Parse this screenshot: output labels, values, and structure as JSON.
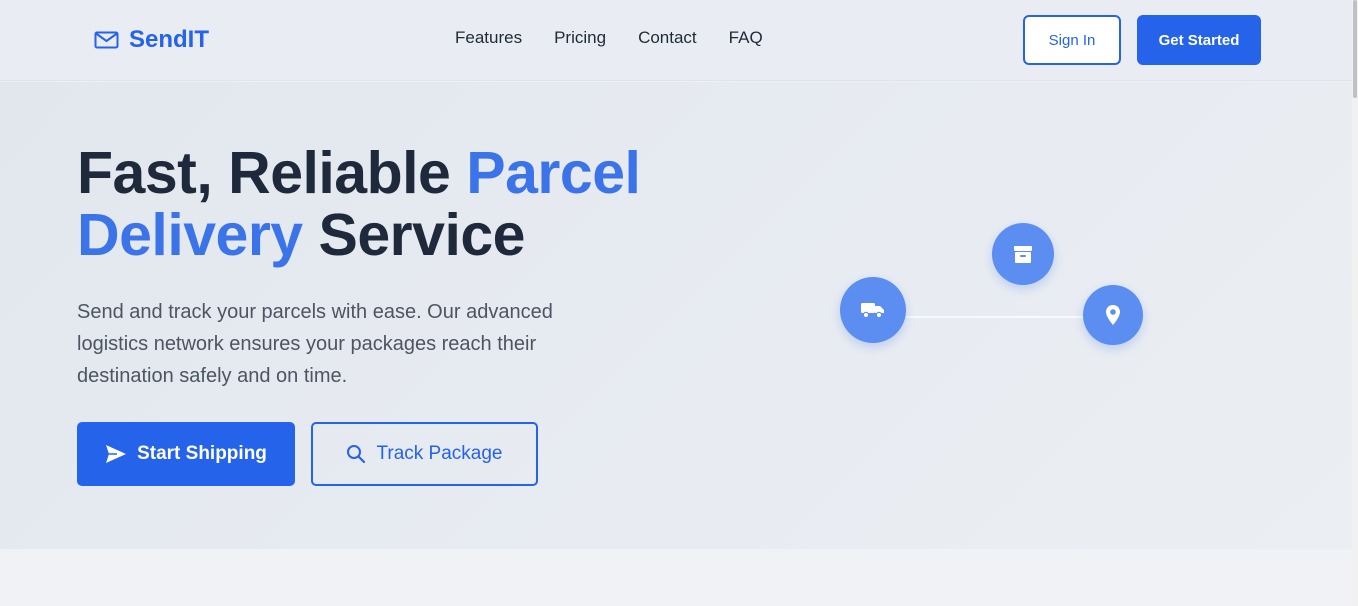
{
  "header": {
    "brand": "SendIT",
    "nav": [
      "Features",
      "Pricing",
      "Contact",
      "FAQ"
    ],
    "sign_in": "Sign In",
    "get_started": "Get Started"
  },
  "hero": {
    "title_part1": "Fast, Reliable ",
    "title_accent1": "Parcel",
    "title_accent2": "Delivery",
    "title_part2": " Service",
    "subtitle": "Send and track your parcels with ease. Our advanced logistics network ensures your packages reach their destination safely and on time.",
    "start_shipping": "Start Shipping",
    "track_package": "Track Package"
  },
  "illustration": {
    "icons": [
      "truck-icon",
      "archive-box-icon",
      "map-pin-icon"
    ]
  },
  "colors": {
    "accent": "#2563eb",
    "headline": "#1e293b",
    "circle": "#5b8ef0"
  }
}
